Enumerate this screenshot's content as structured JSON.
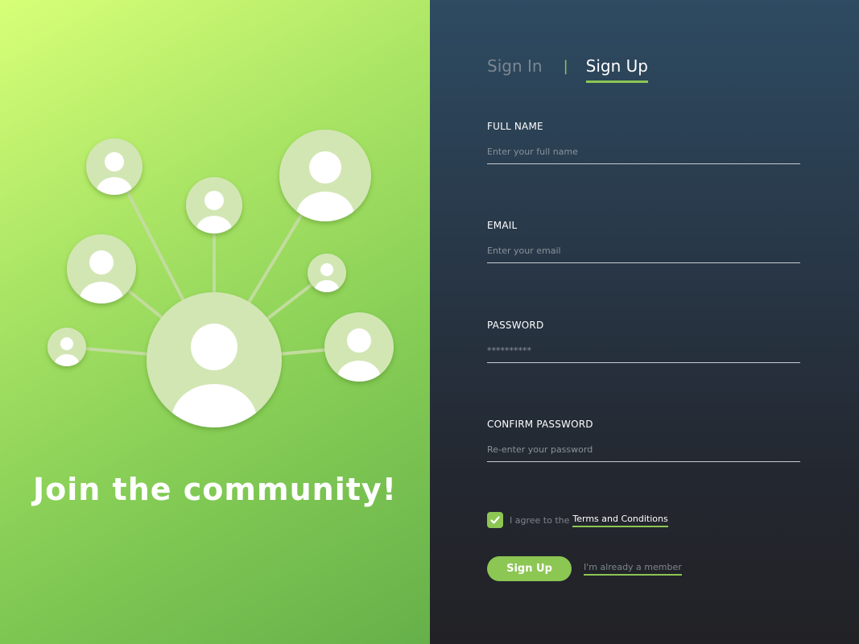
{
  "hero": {
    "tagline": "Join the community!"
  },
  "tabs": [
    {
      "label": "Sign In",
      "active": false
    },
    {
      "separator": "|"
    },
    {
      "label": "Sign Up",
      "active": true
    }
  ],
  "form": {
    "full_name": {
      "label": "FULL NAME",
      "placeholder": "Enter your full name",
      "value": ""
    },
    "email": {
      "label": "EMAIL",
      "placeholder": "Enter your email",
      "value": ""
    },
    "password": {
      "label": "PASSWORD",
      "placeholder": "**********",
      "value": ""
    },
    "confirm_password": {
      "label": "CONFIRM PASSWORD",
      "placeholder": "Re-enter your password",
      "value": ""
    },
    "agree": {
      "checked": true,
      "text": "I agree to the",
      "link_text": "Terms and Conditions"
    },
    "submit_label": "Sign Up",
    "member_link": "I'm already a member"
  },
  "icons": [
    "user-avatar-icon",
    "check-icon"
  ],
  "colors": {
    "accent": "#8cc653",
    "left_bg_start": "#d7ff78",
    "left_bg_end": "#66b04a",
    "right_bg_top": "#2e4b62",
    "right_bg_bottom": "#222226",
    "avatar_circle": "#d2e6b4"
  }
}
